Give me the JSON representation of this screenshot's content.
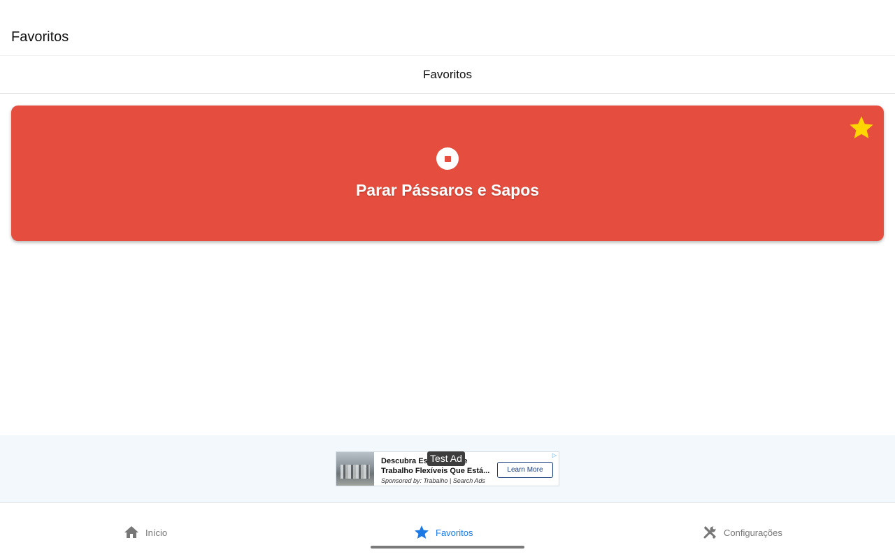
{
  "appbar": {
    "title": "Favoritos"
  },
  "section": {
    "header": "Favoritos"
  },
  "favorites": [
    {
      "label": "Parar Pássaros e Sapos",
      "color": "#e54d3e",
      "icon": "stop-circle-icon",
      "starred": true,
      "star_color": "#ffd600"
    }
  ],
  "ad": {
    "badge": "Test Ad",
    "title_line1": "Descubra Es",
    "title_line1_tail": "de",
    "title_line2": "Trabalho Flexíveis Que Está...",
    "sponsor": "Sponsored by: Trabalho | Search Ads",
    "cta": "Learn More",
    "choices_icon": "ad-choices-icon"
  },
  "nav": {
    "items": [
      {
        "label": "Início",
        "icon": "home-icon",
        "active": false
      },
      {
        "label": "Favoritos",
        "icon": "star-icon",
        "active": true
      },
      {
        "label": "Configurações",
        "icon": "tools-icon",
        "active": false
      }
    ],
    "active_color": "#1b7ae6",
    "inactive_color": "#777777"
  }
}
